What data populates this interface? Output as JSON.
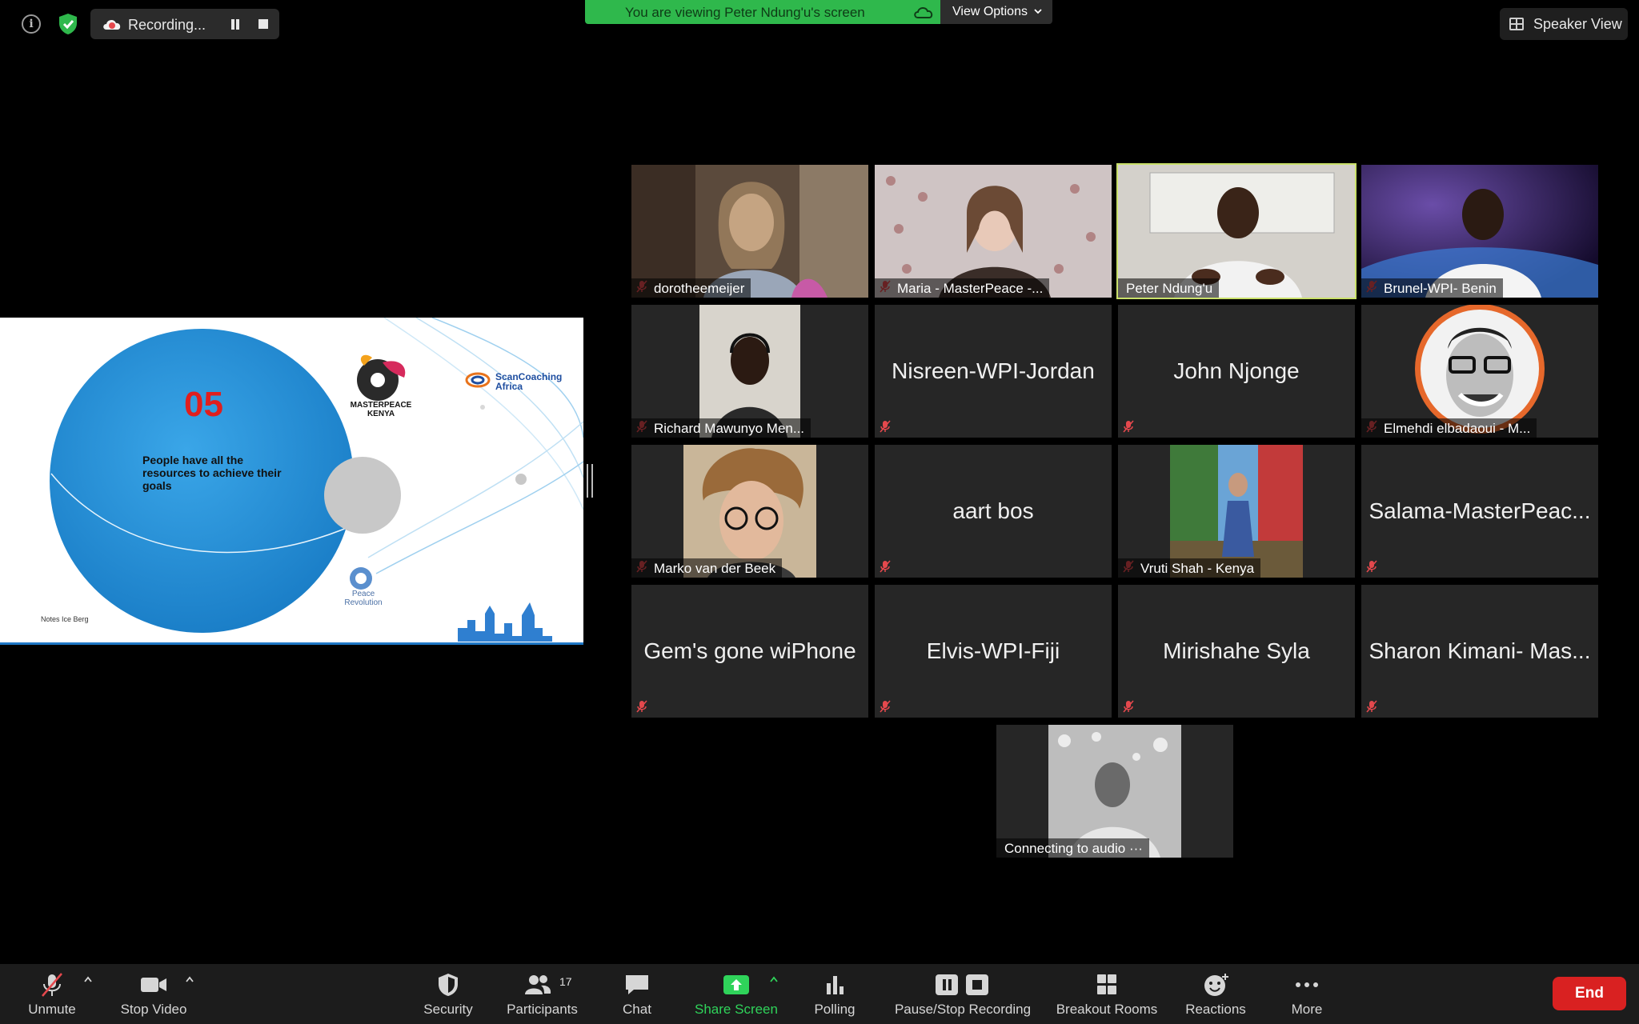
{
  "top_bar": {
    "recording_label": "Recording...",
    "viewing_banner": "You are viewing Peter Ndung'u's screen",
    "view_options_label": "View Options",
    "speaker_view_label": "Speaker View"
  },
  "slide": {
    "number": "05",
    "caption": "People have all the resources to achieve their goals",
    "notes": "Notes Ice Berg",
    "logos": {
      "masterpeace": "MASTERPEACE KENYA",
      "scancoaching": "ScanCoaching Africa",
      "peace_revolution": "Peace Revolution"
    }
  },
  "participants": [
    {
      "name": "dorotheemeijer",
      "muted": true,
      "video": true,
      "active": false
    },
    {
      "name": "Maria - MasterPeace -...",
      "muted": true,
      "video": true,
      "active": false
    },
    {
      "name": "Peter Ndung'u",
      "muted": false,
      "video": true,
      "active": true
    },
    {
      "name": "Brunel-WPI- Benin",
      "muted": true,
      "video": true,
      "active": false
    },
    {
      "name": "Richard Mawunyo Men...",
      "muted": true,
      "video": true,
      "active": false
    },
    {
      "name": "Nisreen-WPI-Jordan",
      "muted": true,
      "video": false,
      "active": false
    },
    {
      "name": "John Njonge",
      "muted": true,
      "video": false,
      "active": false
    },
    {
      "name": "Elmehdi elbadaoui - M...",
      "muted": true,
      "video": true,
      "active": false
    },
    {
      "name": "Marko van der Beek",
      "muted": true,
      "video": true,
      "active": false
    },
    {
      "name": "aart bos",
      "muted": true,
      "video": false,
      "active": false
    },
    {
      "name": "Vruti Shah - Kenya",
      "muted": true,
      "video": true,
      "active": false
    },
    {
      "name": "Salama-MasterPeac...",
      "muted": true,
      "video": false,
      "active": false
    },
    {
      "name": "Gem's gone wiPhone",
      "muted": true,
      "video": false,
      "active": false
    },
    {
      "name": "Elvis-WPI-Fiji",
      "muted": true,
      "video": false,
      "active": false
    },
    {
      "name": "Mirishahe Syla",
      "muted": true,
      "video": false,
      "active": false
    },
    {
      "name": "Sharon Kimani- Mas...",
      "muted": true,
      "video": false,
      "active": false
    },
    {
      "name": "Connecting to audio ···",
      "muted": false,
      "video": true,
      "active": false
    }
  ],
  "toolbar": {
    "unmute": "Unmute",
    "stop_video": "Stop Video",
    "security": "Security",
    "participants": "Participants",
    "participants_count": "17",
    "chat": "Chat",
    "share_screen": "Share Screen",
    "polling": "Polling",
    "pause_stop_recording": "Pause/Stop Recording",
    "breakout_rooms": "Breakout Rooms",
    "reactions": "Reactions",
    "more": "More",
    "end": "End"
  },
  "colors": {
    "banner_green": "#2fb84c",
    "active_speaker_border": "#c9e06a",
    "end_red": "#d92121",
    "share_green": "#2fd35a",
    "mute_red": "#e5484d"
  }
}
